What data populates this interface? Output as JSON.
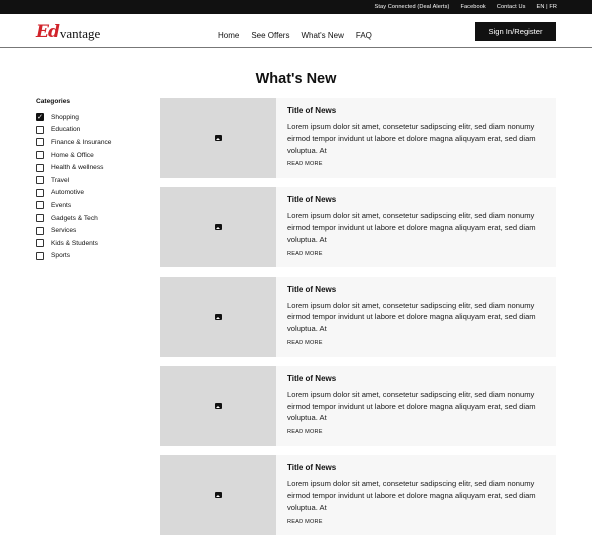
{
  "topbar": {
    "links": [
      "Stay Connected (Deal Alerts)",
      "Facebook",
      "Contact Us",
      "EN | FR"
    ]
  },
  "logo": {
    "mark": "Ed",
    "text": "vantage"
  },
  "nav": {
    "items": [
      "Home",
      "See Offers",
      "What's New",
      "FAQ"
    ],
    "signin": "Sign In/Register"
  },
  "page": {
    "title": "What's New"
  },
  "categories": {
    "title": "Categories",
    "items": [
      {
        "label": "Shopping",
        "checked": true
      },
      {
        "label": "Education",
        "checked": false
      },
      {
        "label": "Finance & Insurance",
        "checked": false
      },
      {
        "label": "Home & Office",
        "checked": false
      },
      {
        "label": "Health & wellness",
        "checked": false
      },
      {
        "label": "Travel",
        "checked": false
      },
      {
        "label": "Automotive",
        "checked": false
      },
      {
        "label": "Events",
        "checked": false
      },
      {
        "label": "Gadgets & Tech",
        "checked": false
      },
      {
        "label": "Services",
        "checked": false
      },
      {
        "label": "Kids & Students",
        "checked": false
      },
      {
        "label": "Sports",
        "checked": false
      }
    ]
  },
  "news": [
    {
      "title": "Title of News",
      "text": "Lorem ipsum dolor sit amet, consetetur sadipscing elitr, sed diam nonumy eirmod tempor invidunt ut labore et dolore magna aliquyam erat, sed diam voluptua. At",
      "more": "READ MORE"
    },
    {
      "title": "Title of News",
      "text": "Lorem ipsum dolor sit amet, consetetur sadipscing elitr, sed diam nonumy eirmod tempor invidunt ut labore et dolore magna aliquyam erat, sed diam voluptua. At",
      "more": "READ MORE"
    },
    {
      "title": "Title of News",
      "text": "Lorem ipsum dolor sit amet, consetetur sadipscing elitr, sed diam nonumy eirmod tempor invidunt ut labore et dolore magna aliquyam erat, sed diam voluptua. At",
      "more": "READ MORE"
    },
    {
      "title": "Title of News",
      "text": "Lorem ipsum dolor sit amet, consetetur sadipscing elitr, sed diam nonumy eirmod tempor invidunt ut labore et dolore magna aliquyam erat, sed diam voluptua. At",
      "more": "READ MORE"
    },
    {
      "title": "Title of News",
      "text": "Lorem ipsum dolor sit amet, consetetur sadipscing elitr, sed diam nonumy eirmod tempor invidunt ut labore et dolore magna aliquyam erat, sed diam voluptua. At",
      "more": "READ MORE"
    }
  ],
  "icons": {
    "thumbnail": "image-icon",
    "checkbox_checked": "check-icon"
  }
}
